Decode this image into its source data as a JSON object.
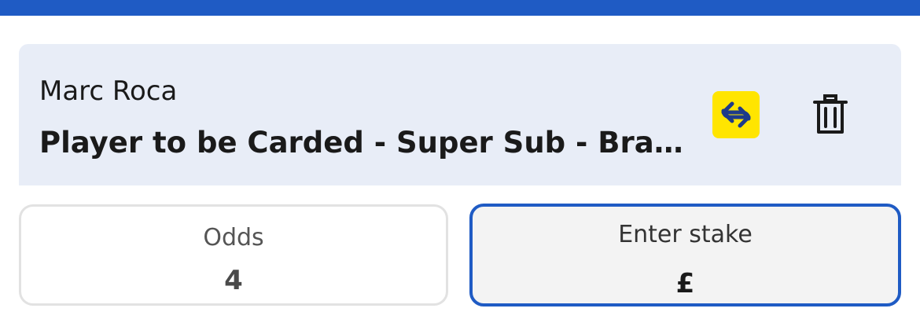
{
  "bet": {
    "player_name": "Marc Roca",
    "market": "Player to be Carded - Super Sub - Brag..."
  },
  "actions": {
    "swap_icon": "swap-arrows-icon",
    "delete_icon": "trash-icon"
  },
  "odds": {
    "label": "Odds",
    "value": "4"
  },
  "stake": {
    "label": "Enter stake",
    "currency": "£"
  },
  "colors": {
    "brand_blue": "#1f5bc4",
    "card_background": "#e8edf7",
    "swap_yellow": "#ffe500",
    "icon_navy": "#1e3a8a"
  }
}
